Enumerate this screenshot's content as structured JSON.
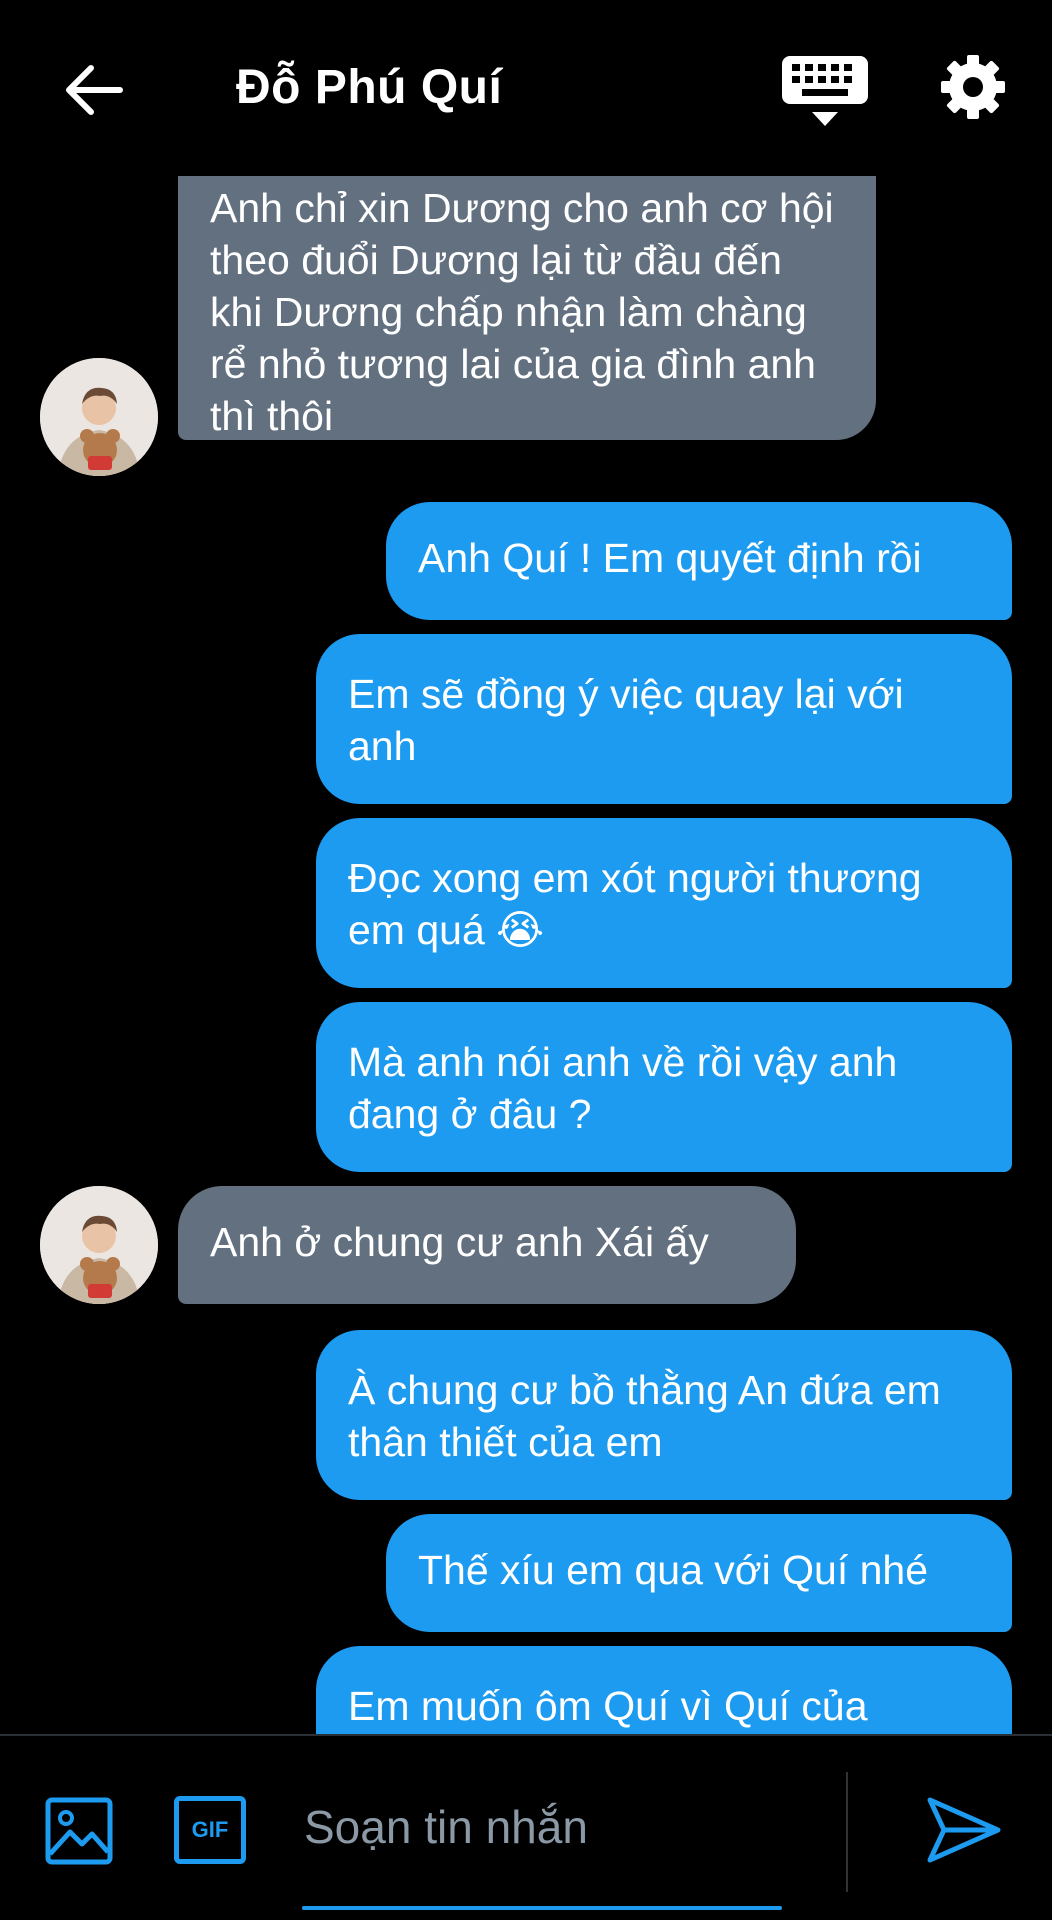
{
  "header": {
    "contact_name": "Đỗ Phú Quí"
  },
  "icons": {
    "back": "arrow-left-icon",
    "keyboard": "keyboard-icon",
    "settings": "gear-icon",
    "image": "image-icon",
    "gif": "gif-icon",
    "send": "send-icon"
  },
  "colors": {
    "incoming_bubble": "#627080",
    "outgoing_bubble": "#1d9bf0",
    "accent": "#1d9bf0",
    "background": "#000000"
  },
  "messages": [
    {
      "direction": "incoming",
      "text": "Anh chỉ xin Dương cho anh cơ hội theo đuổi Dương lại từ đầu đến khi Dương chấp nhận làm chàng rể nhỏ tương lai của gia đình anh thì thôi"
    },
    {
      "direction": "outgoing",
      "text": "Anh Quí ! Em quyết định rồi"
    },
    {
      "direction": "outgoing",
      "text": "Em sẽ đồng ý việc quay lại với anh"
    },
    {
      "direction": "outgoing",
      "text": "Đọc xong em xót người thương em quá 😭"
    },
    {
      "direction": "outgoing",
      "text": "Mà anh nói anh về rồi vậy anh đang ở đâu ?"
    },
    {
      "direction": "incoming",
      "text": "Anh ở chung cư anh Xái ấy"
    },
    {
      "direction": "outgoing",
      "text": "À chung cư bồ thằng An đứa em thân thiết của em"
    },
    {
      "direction": "outgoing",
      "text": "Thế xíu em qua với Quí nhé"
    },
    {
      "direction": "outgoing",
      "text": "Em muốn ôm Quí vì Quí của"
    }
  ],
  "composer": {
    "placeholder": "Soạn tin nhắn",
    "gif_label": "GIF"
  }
}
